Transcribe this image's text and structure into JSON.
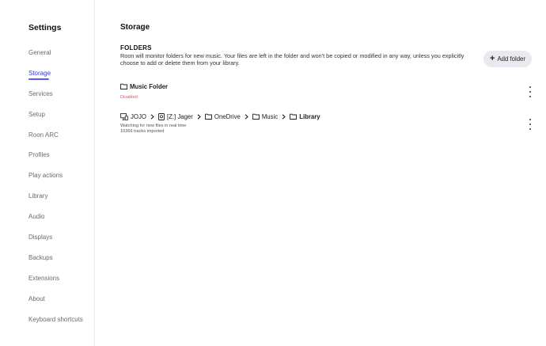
{
  "sidebar": {
    "title": "Settings",
    "items": [
      {
        "label": "General",
        "active": false
      },
      {
        "label": "Storage",
        "active": true
      },
      {
        "label": "Services",
        "active": false
      },
      {
        "label": "Setup",
        "active": false
      },
      {
        "label": "Roon ARC",
        "active": false
      },
      {
        "label": "Profiles",
        "active": false
      },
      {
        "label": "Play actions",
        "active": false
      },
      {
        "label": "Library",
        "active": false
      },
      {
        "label": "Audio",
        "active": false
      },
      {
        "label": "Displays",
        "active": false
      },
      {
        "label": "Backups",
        "active": false
      },
      {
        "label": "Extensions",
        "active": false
      },
      {
        "label": "About",
        "active": false
      },
      {
        "label": "Keyboard shortcuts",
        "active": false
      }
    ]
  },
  "main": {
    "title": "Storage",
    "section_heading": "FOLDERS",
    "section_description": "Roon will monitor folders for new music. Your files are left in the folder and won't be copied or modified in any way, unless you explicitly choose to add or delete them from your library.",
    "add_folder_label": "Add folder",
    "folders": [
      {
        "name": "Music Folder",
        "status": "Disabled"
      },
      {
        "path": [
          "JOJO",
          "[Z:] Jager",
          "OneDrive",
          "Music",
          "Library"
        ],
        "status_lines": [
          "Watching for new files in real time",
          "10366 tracks imported"
        ]
      }
    ]
  },
  "colors": {
    "accent": "#5c5ce6",
    "disabled": "#e0585a",
    "button_bg": "#e8eaf0"
  },
  "icons": {
    "folder": "folder-icon",
    "computer": "computer-icon",
    "drive": "drive-icon",
    "chevron": "chevron-right-icon",
    "menu": "more-vertical-icon",
    "add": "plus-icon"
  }
}
